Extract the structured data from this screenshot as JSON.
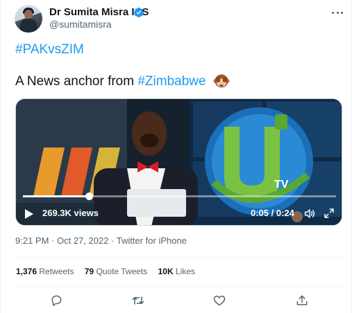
{
  "author": {
    "display_name": "Dr Sumita Misra IAS",
    "handle": "@sumitamisra",
    "verified_icon": "verified-badge-icon",
    "avatar_icon": "avatar"
  },
  "tweet": {
    "hashtag_line": "#PAKvsZIM",
    "text_prefix": "A News anchor from ",
    "text_hashtag": "#Zimbabwe",
    "emoji": "see-no-evil-monkey"
  },
  "video": {
    "views": "269.3K views",
    "timecode": "0:05 / 0:24",
    "progress": 0.21,
    "channel_logo_text": "TV"
  },
  "meta": {
    "time": "9:21 PM",
    "separator": " · ",
    "date": "Oct 27, 2022",
    "source": "Twitter for iPhone"
  },
  "stats": {
    "retweets": {
      "count": "1,376",
      "label": "Retweets"
    },
    "quotes": {
      "count": "79",
      "label": "Quote Tweets"
    },
    "likes": {
      "count": "10K",
      "label": "Likes"
    }
  },
  "actions": [
    "reply-icon",
    "retweet-icon",
    "like-icon",
    "share-icon"
  ],
  "colors": {
    "accent": "#1d9bf0",
    "secondary_text": "#536471",
    "primary_text": "#0f1419"
  }
}
